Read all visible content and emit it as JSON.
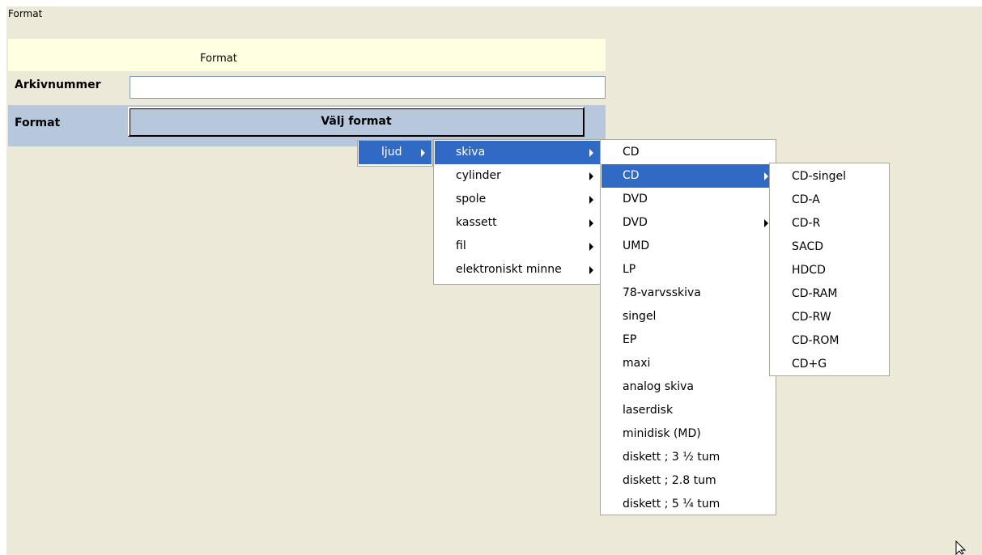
{
  "window": {
    "title": "Format"
  },
  "form": {
    "header_label": "Format",
    "arkivnummer_label": "Arkivnummer",
    "arkivnummer_value": "",
    "format_label": "Format",
    "choose_format_button": "Välj format"
  },
  "menus": {
    "root": {
      "items": [
        {
          "label": "ljud",
          "submenu": true,
          "selected": true
        }
      ]
    },
    "ljud": {
      "items": [
        {
          "label": "skiva",
          "submenu": true,
          "selected": true
        },
        {
          "label": "cylinder",
          "submenu": true
        },
        {
          "label": "spole",
          "submenu": true
        },
        {
          "label": "kassett",
          "submenu": true
        },
        {
          "label": "fil",
          "submenu": true
        },
        {
          "label": "elektroniskt minne",
          "submenu": true
        }
      ]
    },
    "skiva": {
      "items": [
        {
          "label": "CD"
        },
        {
          "label": "CD",
          "submenu": true,
          "selected": true
        },
        {
          "label": "DVD"
        },
        {
          "label": "DVD",
          "submenu": true
        },
        {
          "label": "UMD"
        },
        {
          "label": "LP"
        },
        {
          "label": "78-varvsskiva"
        },
        {
          "label": "singel"
        },
        {
          "label": "EP"
        },
        {
          "label": "maxi"
        },
        {
          "label": "analog skiva"
        },
        {
          "label": "laserdisk"
        },
        {
          "label": "minidisk (MD)"
        },
        {
          "label": "diskett ; 3 ½ tum"
        },
        {
          "label": "diskett ; 2.8 tum"
        },
        {
          "label": "diskett ; 5 ¼ tum"
        }
      ]
    },
    "cd": {
      "items": [
        {
          "label": "CD-singel"
        },
        {
          "label": "CD-A"
        },
        {
          "label": "CD-R"
        },
        {
          "label": "SACD"
        },
        {
          "label": "HDCD"
        },
        {
          "label": "CD-RAM"
        },
        {
          "label": "CD-RW"
        },
        {
          "label": "CD-ROM"
        },
        {
          "label": "CD+G"
        }
      ]
    }
  },
  "colors": {
    "panel_bg": "#ECE9D8",
    "header_bg": "#FFFFE1",
    "format_row_bg": "#B7C8DD",
    "menu_highlight": "#316AC5"
  },
  "icons": {
    "cursor": "mouse-pointer-icon"
  }
}
